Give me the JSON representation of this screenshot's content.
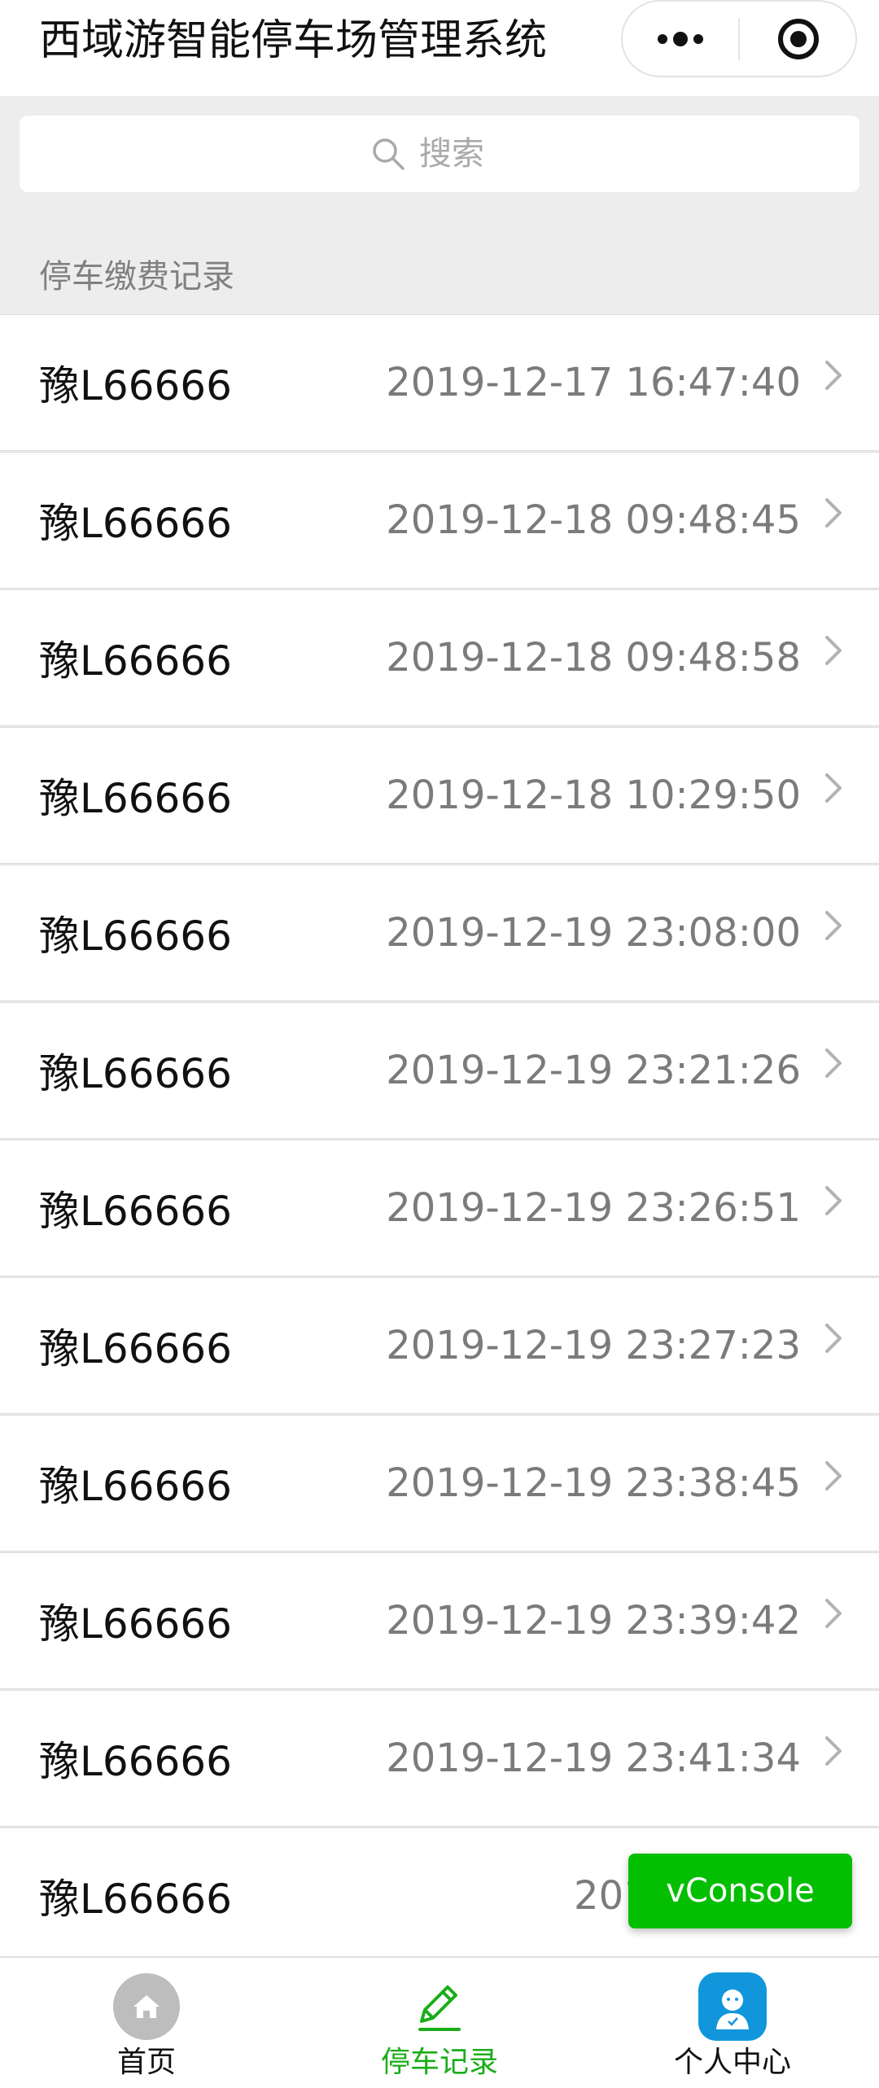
{
  "navbar": {
    "title": "西域游智能停车场管理系统",
    "more_icon": "more-dots-icon",
    "close_icon": "target-close-icon"
  },
  "search": {
    "placeholder": "搜索",
    "icon": "search-icon"
  },
  "section": {
    "title": "停车缴费记录"
  },
  "records": [
    {
      "plate": "豫L66666",
      "time": "2019-12-17 16:47:40"
    },
    {
      "plate": "豫L66666",
      "time": "2019-12-18 09:48:45"
    },
    {
      "plate": "豫L66666",
      "time": "2019-12-18 09:48:58"
    },
    {
      "plate": "豫L66666",
      "time": "2019-12-18 10:29:50"
    },
    {
      "plate": "豫L66666",
      "time": "2019-12-19 23:08:00"
    },
    {
      "plate": "豫L66666",
      "time": "2019-12-19 23:21:26"
    },
    {
      "plate": "豫L66666",
      "time": "2019-12-19 23:26:51"
    },
    {
      "plate": "豫L66666",
      "time": "2019-12-19 23:27:23"
    },
    {
      "plate": "豫L66666",
      "time": "2019-12-19 23:38:45"
    },
    {
      "plate": "豫L66666",
      "time": "2019-12-19 23:39:42"
    },
    {
      "plate": "豫L66666",
      "time": "2019-12-19 23:41:34"
    },
    {
      "plate": "豫L66666",
      "time": "2019-12-19"
    }
  ],
  "vconsole": {
    "label": "vConsole",
    "color": "#04be02"
  },
  "tabbar": {
    "active_color": "#1aad19",
    "inactive_color": "#111111",
    "tabs": [
      {
        "label": "首页",
        "icon": "home-icon",
        "active": false
      },
      {
        "label": "停车记录",
        "icon": "pencil-edit-icon",
        "active": true
      },
      {
        "label": "个人中心",
        "icon": "user-avatar-icon",
        "active": false
      }
    ]
  }
}
